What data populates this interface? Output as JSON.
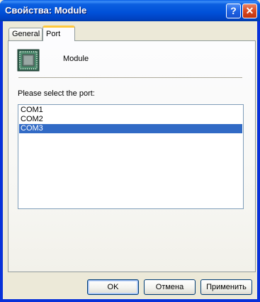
{
  "window": {
    "title": "Свойства: Module",
    "help_label": "?",
    "close_label": "✕"
  },
  "tabs": [
    {
      "label": "General",
      "active": false
    },
    {
      "label": "Port",
      "active": true
    }
  ],
  "panel": {
    "device_name": "Module",
    "device_icon": "chip-icon",
    "prompt": "Please select the port:",
    "ports": [
      "COM1",
      "COM2",
      "COM3"
    ],
    "selected_port": "COM3"
  },
  "buttons": {
    "ok": "OK",
    "cancel": "Отмена",
    "apply": "Применить"
  },
  "colors": {
    "titlebar": "#0054e3",
    "selection": "#316ac5",
    "active_tab_accent": "#ffc83c"
  }
}
